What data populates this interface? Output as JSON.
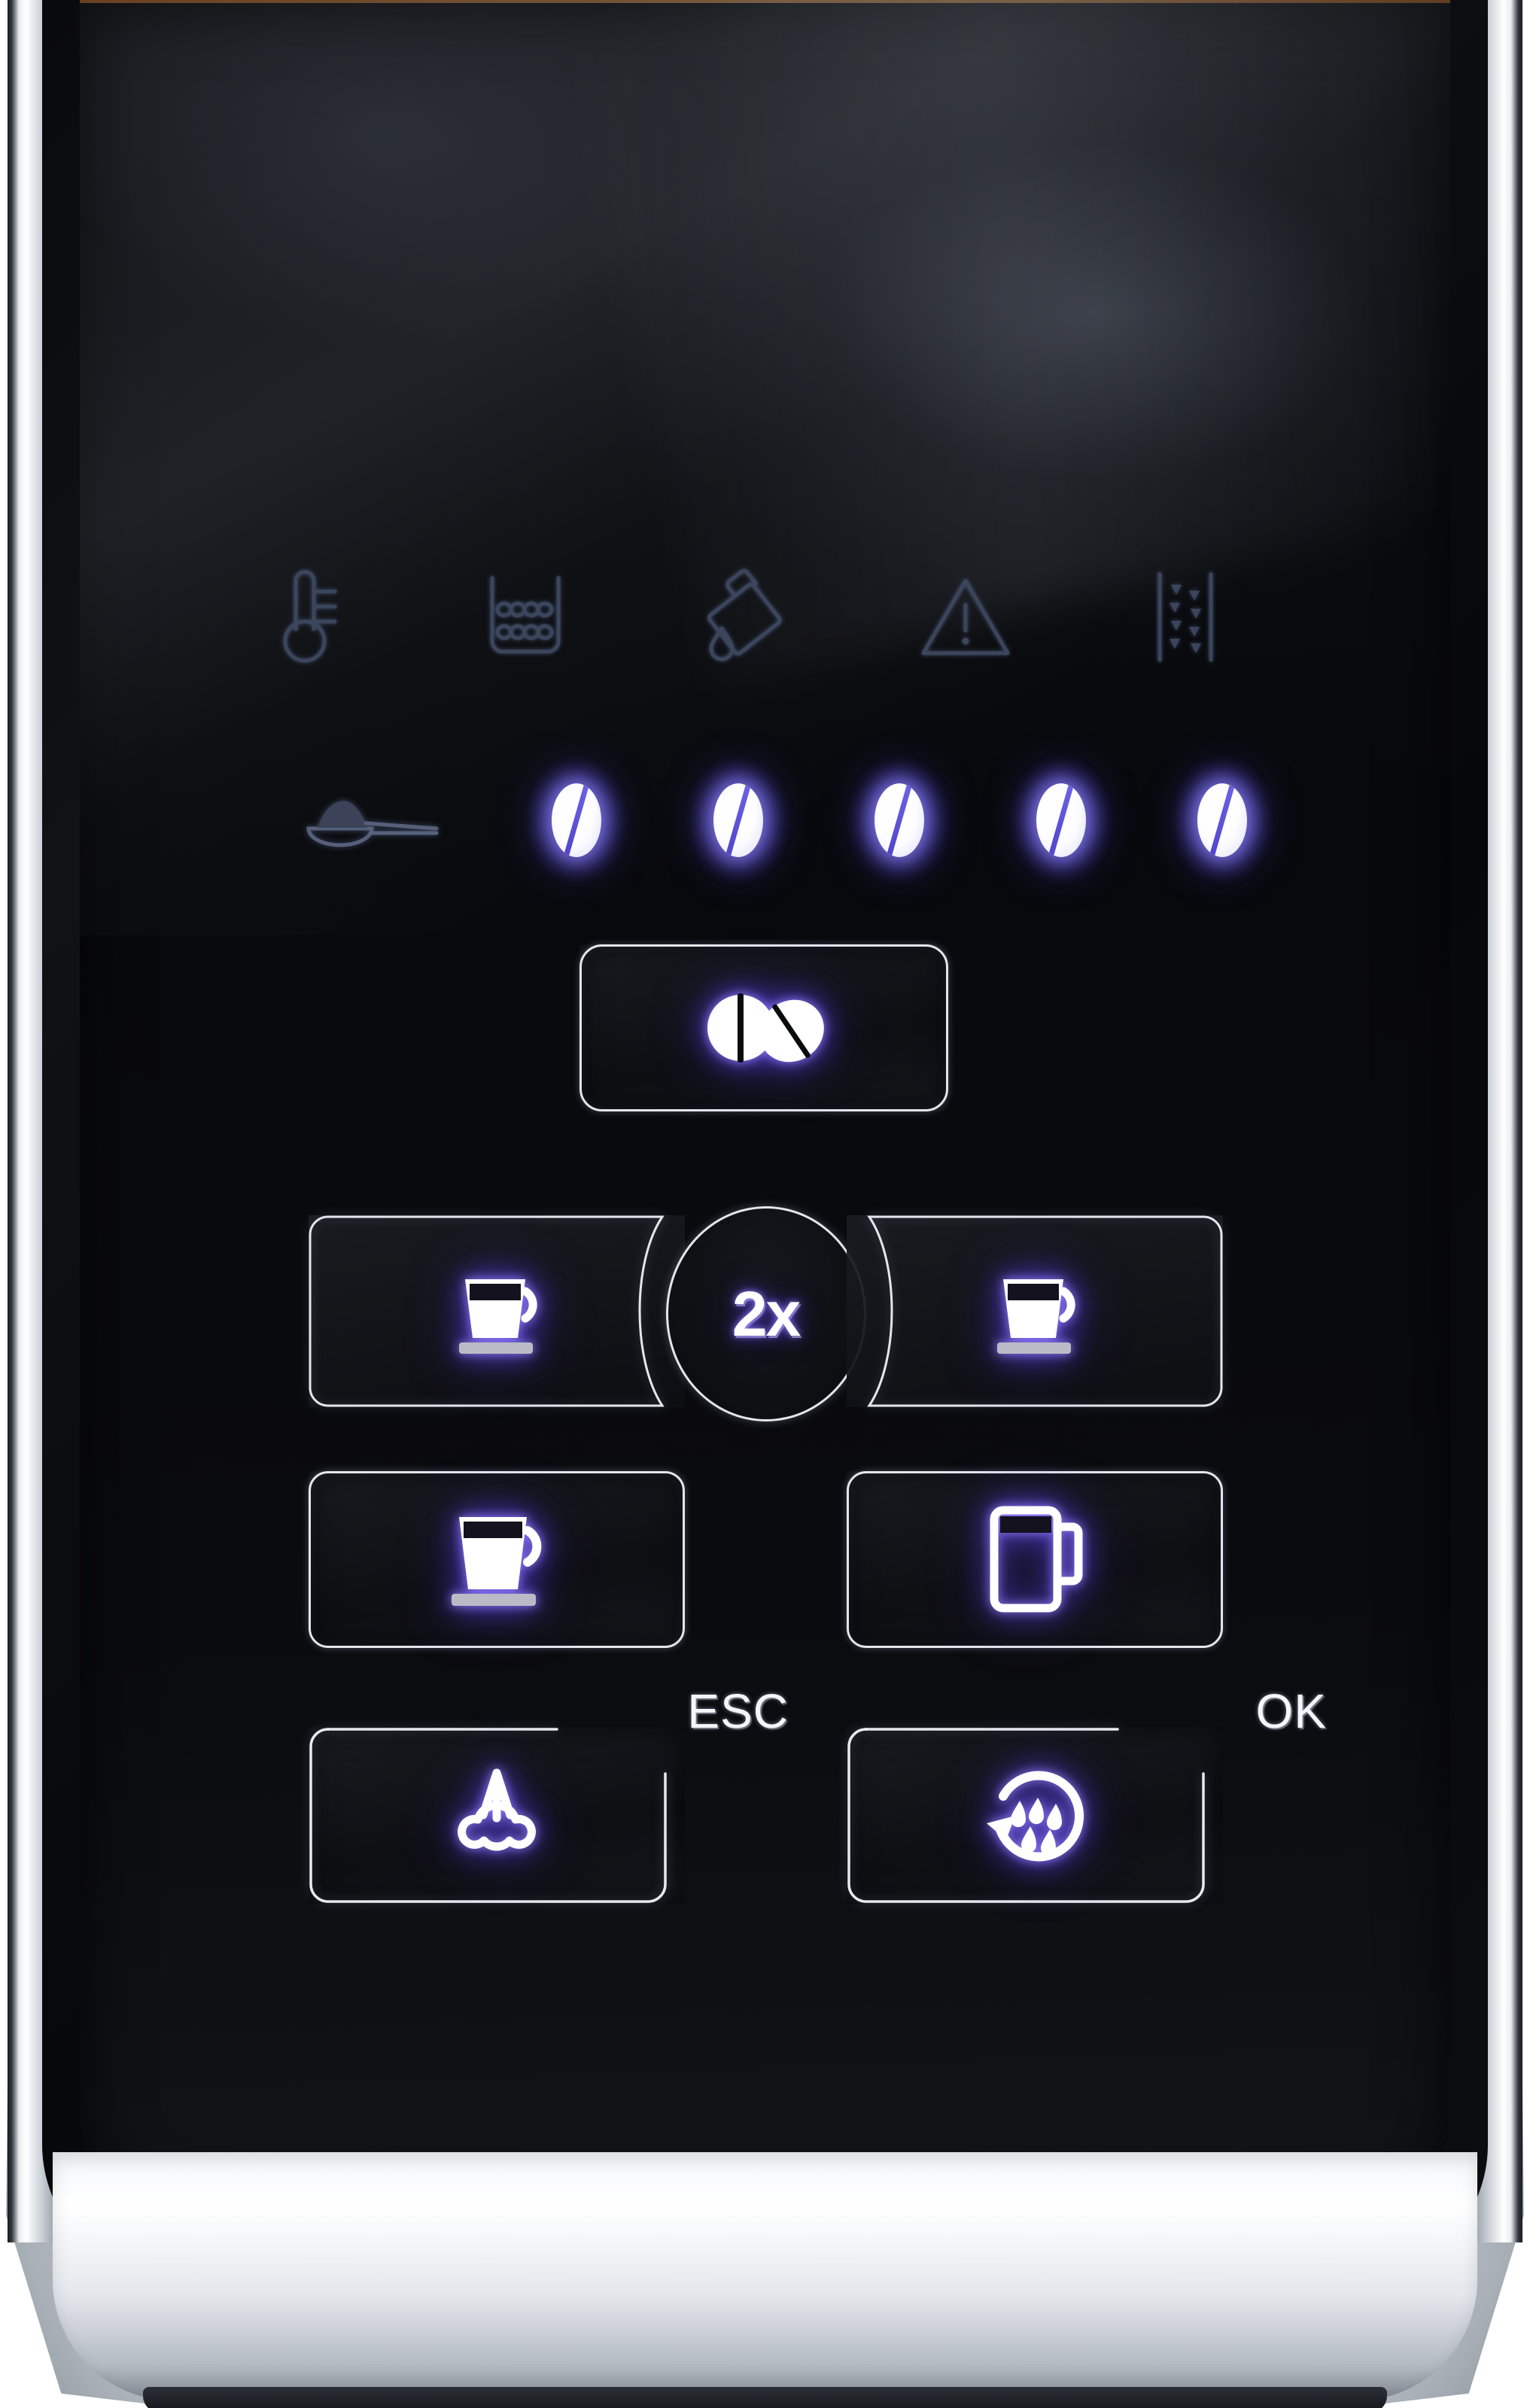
{
  "device": {
    "type": "espresso-machine-control-panel",
    "finish_colors": {
      "panel_black": "#0a0b0e",
      "chrome": "#e9ecef",
      "lamp_white": "#ffffff",
      "lamp_glow_blue": "#6f63e8",
      "status_icon_dim": "#3d485f"
    }
  },
  "status_indicators": {
    "label": "status-indicator-row",
    "items": [
      {
        "id": "temperature",
        "icon": "thermometer-icon",
        "state": "off"
      },
      {
        "id": "grounds-container",
        "icon": "grounds-container-icon",
        "state": "off"
      },
      {
        "id": "water-tank",
        "icon": "water-tank-pour-icon",
        "state": "off"
      },
      {
        "id": "general-warning",
        "icon": "warning-triangle-icon",
        "state": "off"
      },
      {
        "id": "water-filter",
        "icon": "water-filter-icon",
        "state": "off"
      }
    ]
  },
  "strength_row": {
    "ground_coffee": {
      "icon": "coffee-scoop-icon",
      "state": "off"
    },
    "lamp_count": 5,
    "lamps_lit": 5,
    "lamp_icon": "coffee-bean-lamp-icon"
  },
  "buttons": {
    "bean_strength": {
      "id": "bean-strength",
      "icon": "two-coffee-beans-icon",
      "label": "",
      "lit": true
    },
    "espresso_left": {
      "id": "espresso-left",
      "icon": "espresso-cup-icon",
      "label": "",
      "lit": true
    },
    "double_shot": {
      "id": "double-shot",
      "icon": "",
      "label": "2x",
      "lit": true
    },
    "espresso_right": {
      "id": "espresso-right",
      "icon": "espresso-cup-icon",
      "label": "",
      "lit": true
    },
    "coffee": {
      "id": "coffee",
      "icon": "coffee-cup-icon",
      "label": "",
      "lit": true
    },
    "latte_macchiato": {
      "id": "latte-macchiato",
      "icon": "tall-glass-mug-icon",
      "label": "",
      "lit": true
    },
    "steam_esc": {
      "id": "steam-esc",
      "icon": "steam-nozzle-icon",
      "label": "ESC",
      "lit": true
    },
    "rinse_ok": {
      "id": "rinse-ok",
      "icon": "rinse-cycle-icon",
      "label": "OK",
      "lit": true
    }
  }
}
